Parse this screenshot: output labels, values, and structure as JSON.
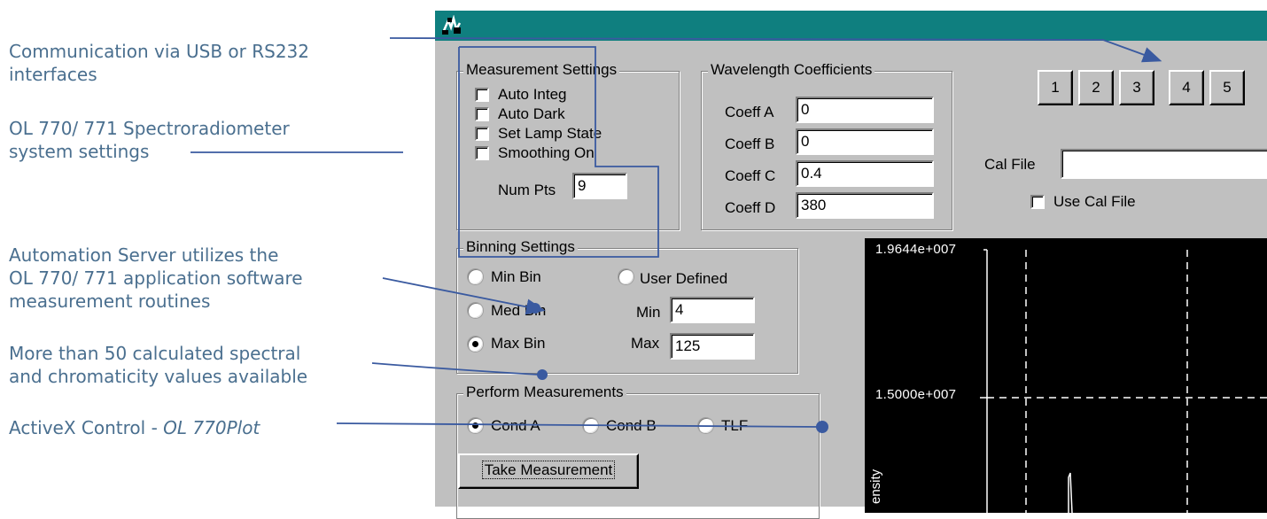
{
  "annotations": [
    {
      "line1": "Communication via USB or RS232",
      "line2": "interfaces"
    },
    {
      "line1": "OL 770/ 771 Spectroradiometer",
      "line2": "system settings"
    },
    {
      "line1": "Automation Server utilizes the",
      "line2": "OL 770/ 771 application software",
      "line3": "measurement routines"
    },
    {
      "line1": "More than 50 calculated spectral",
      "line2": "and chromaticity values available"
    },
    {
      "prefix": "ActiveX Control - ",
      "emphasis": "OL 770Plot"
    }
  ],
  "window": {
    "titlebar_color": "#0f7f7f",
    "measurement_settings": {
      "title": "Measurement Settings",
      "checkboxes": [
        {
          "label": "Auto Integ",
          "checked": false
        },
        {
          "label": "Auto Dark",
          "checked": false
        },
        {
          "label": "Set Lamp State",
          "checked": false
        },
        {
          "label": "Smoothing On",
          "checked": false
        }
      ],
      "num_pts_label": "Num Pts",
      "num_pts_value": "9"
    },
    "wavelength_coefficients": {
      "title": "Wavelength Coefficients",
      "rows": [
        {
          "label": "Coeff A",
          "value": "0"
        },
        {
          "label": "Coeff B",
          "value": "0"
        },
        {
          "label": "Coeff C",
          "value": "0.4"
        },
        {
          "label": "Coeff D",
          "value": "380"
        }
      ]
    },
    "number_buttons": [
      "1",
      "2",
      "3",
      "4",
      "5"
    ],
    "cal_file_label": "Cal File",
    "cal_file_value": "",
    "use_cal_file_label": "Use Cal File",
    "binning_settings": {
      "title": "Binning Settings",
      "options": [
        {
          "label": "Min Bin",
          "selected": false
        },
        {
          "label": "Med Bin",
          "selected": false
        },
        {
          "label": "Max Bin",
          "selected": true
        },
        {
          "label": "User Defined",
          "selected": false
        }
      ],
      "min_label": "Min",
      "min_value": "4",
      "max_label": "Max",
      "max_value": "125"
    },
    "perform_measurements": {
      "title": "Perform Measurements",
      "options": [
        {
          "label": "Cond A",
          "selected": true
        },
        {
          "label": "Cond B",
          "selected": false
        },
        {
          "label": "TLF",
          "selected": false
        }
      ],
      "button_label": "Take Measurement"
    },
    "plot": {
      "ytick_top": "1.9644e+007",
      "ytick_mid": "1.5000e+007",
      "ylabel": "ensity"
    }
  }
}
